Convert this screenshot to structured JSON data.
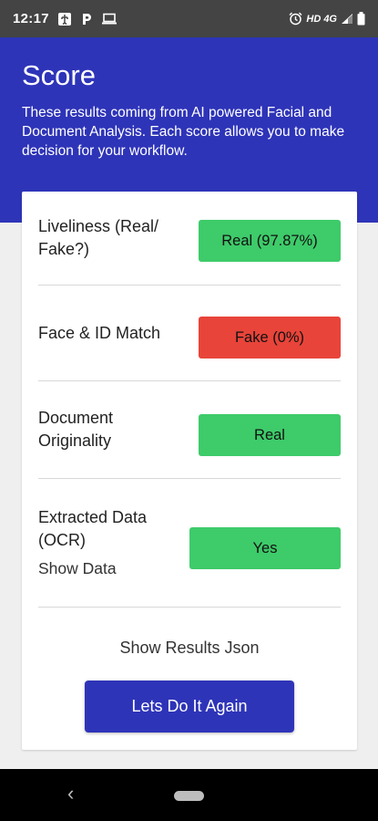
{
  "status_bar": {
    "time": "12:17",
    "network_label": "HD 4G",
    "left_icons": [
      "usb-icon",
      "parking-icon",
      "laptop-icon"
    ],
    "right_icons": [
      "alarm-icon",
      "signal-icon",
      "battery-icon"
    ]
  },
  "header": {
    "title": "Score",
    "description": "These results coming from AI powered Facial and Document Analysis. Each score allows you to make decision for your workflow."
  },
  "results": [
    {
      "label": "Liveliness (Real/ Fake?)",
      "value": "Real (97.87%)",
      "status": "green"
    },
    {
      "label": "Face & ID Match",
      "value": "Fake (0%)",
      "status": "red"
    },
    {
      "label": "Document Originality",
      "value": "Real",
      "status": "green"
    },
    {
      "label": "Extracted Data (OCR)",
      "sub_link": "Show Data",
      "value": "Yes",
      "status": "green"
    }
  ],
  "show_results_json": "Show Results Json",
  "again_button": "Lets Do It Again",
  "colors": {
    "primary": "#2e34b8",
    "success": "#3ecb6a",
    "danger": "#e8443a",
    "status_bar": "#444444"
  }
}
